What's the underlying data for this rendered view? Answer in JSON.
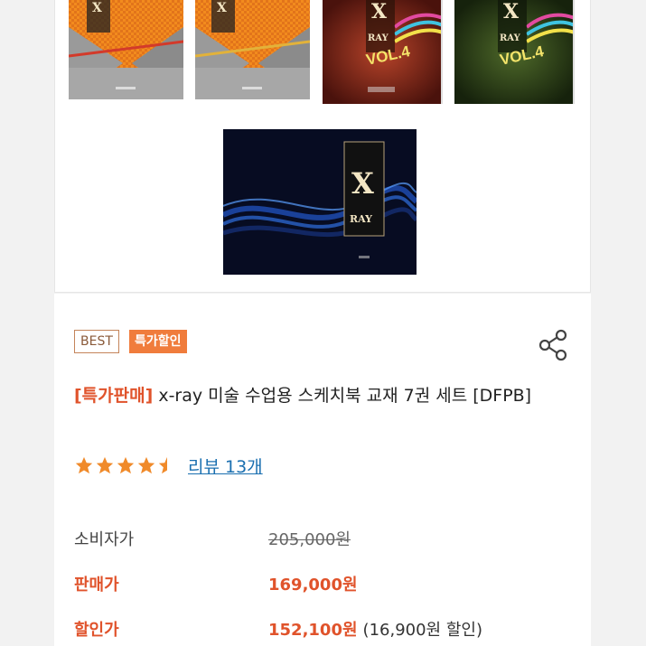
{
  "gallery": {
    "covers": [
      {
        "name": "cover-1",
        "text": "X\nRAY"
      },
      {
        "name": "cover-2",
        "text": "X\nRAY"
      },
      {
        "name": "cover-3",
        "text": "X\nRAY",
        "vol": "VOL.4"
      },
      {
        "name": "cover-4",
        "text": "X\nRAY",
        "vol": "VOL.4"
      },
      {
        "name": "cover-5",
        "text": "X\nRAY"
      }
    ]
  },
  "product": {
    "badges": {
      "best": "BEST",
      "sale": "특가할인"
    },
    "title_tag": "[특가판매]",
    "title_main": " x-ray 미술 수업용 스케치북 교재 7권 세트 [DFPB]",
    "rating_value": 4.5,
    "review_link": "리뷰 13개"
  },
  "prices": {
    "consumer_label": "소비자가",
    "consumer_value": "205,000원",
    "sell_label": "판매가",
    "sell_value": "169,000원",
    "discount_label": "할인가",
    "discount_value": "152,100원",
    "discount_note": "(16,900원 할인)"
  },
  "colors": {
    "accent": "#e0532b",
    "badge_sale_bg": "#f07c3c",
    "star": "#f08a2a",
    "link": "#1a6fb0"
  },
  "icons": {
    "share": "share-icon",
    "star": "star-icon"
  }
}
